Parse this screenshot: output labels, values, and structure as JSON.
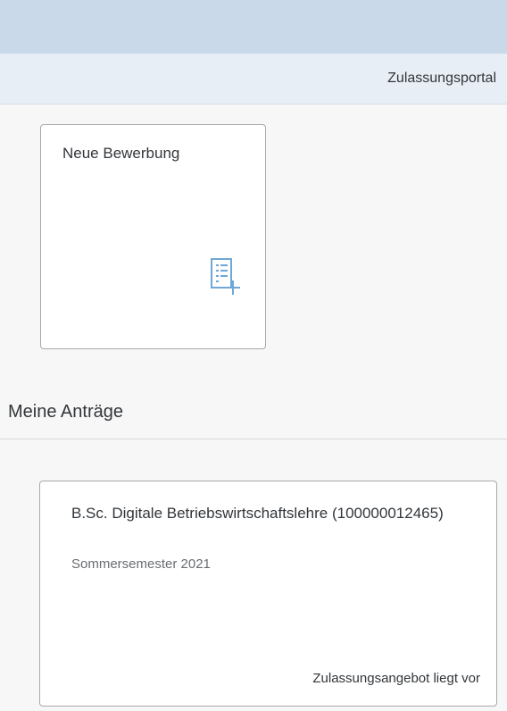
{
  "header": {
    "portal_title": "Zulassungsportal"
  },
  "new_application_tile": {
    "title": "Neue Bewerbung",
    "icon": "document-add-icon"
  },
  "my_applications": {
    "heading": "Meine Anträge",
    "items": [
      {
        "title": "B.Sc. Digitale Betriebswirtschaftslehre (100000012465)",
        "semester": "Sommersemester 2021",
        "status": "Zulassungsangebot liegt vor"
      }
    ]
  },
  "colors": {
    "top_bar": "#c9d9ea",
    "sub_header": "#e7eef6",
    "accent": "#6fa7d6",
    "background": "#f7f7f7"
  }
}
